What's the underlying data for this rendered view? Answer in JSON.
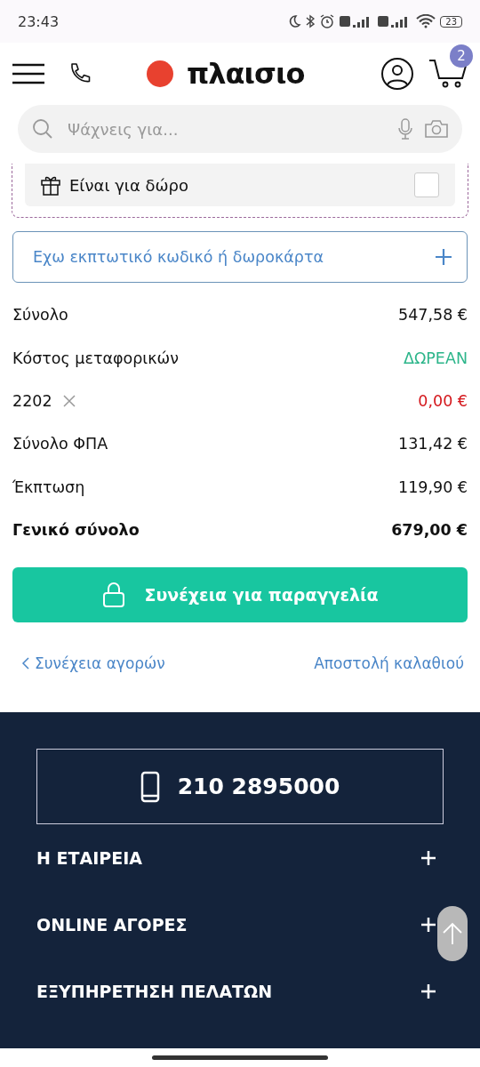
{
  "status_bar": {
    "time": "23:43",
    "battery": "23"
  },
  "header": {
    "logo": "πλαισιο",
    "cart_count": "2"
  },
  "search": {
    "placeholder": "Ψάχνεις για..."
  },
  "gift": {
    "label": "Είναι για δώρο",
    "checked": false
  },
  "coupon": {
    "label": "Εχω εκπτωτικό κωδικό ή δωροκάρτα"
  },
  "summary": [
    {
      "kind": "plain",
      "label": "Σύνολο",
      "value": "547,58 €"
    },
    {
      "kind": "free",
      "label": "Κόστος μεταφορικών",
      "value": "ΔΩΡΕΑΝ"
    },
    {
      "kind": "coupon",
      "label": "2202",
      "value": "0,00 €"
    },
    {
      "kind": "plain",
      "label": "Σύνολο ΦΠΑ",
      "value": "131,42 €"
    },
    {
      "kind": "plain",
      "label": "Έκπτωση",
      "value": "119,90 €"
    },
    {
      "kind": "total",
      "label": "Γενικό σύνολο",
      "value": "679,00 €"
    }
  ],
  "checkout_button": "Συνέχεια για παραγγελία",
  "links": {
    "back": "Συνέχεια αγορών",
    "send": "Αποστολή καλαθιού"
  },
  "footer": {
    "phone": "210 2895000",
    "sections": [
      {
        "label": "Η ΕΤΑΙΡΕΙΑ",
        "expanded": false
      },
      {
        "label": "ONLINE ΑΓΟΡΕΣ",
        "expanded": false
      },
      {
        "label": "ΕΞΥΠΗΡΕΤΗΣΗ ΠΕΛΑΤΩΝ",
        "expanded": false
      }
    ]
  }
}
